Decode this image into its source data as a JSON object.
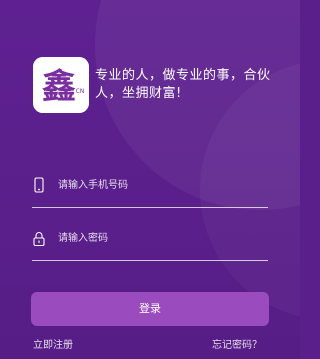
{
  "header": {
    "logo_text": "鑫",
    "logo_sub": "CN",
    "slogan": "专业的人，做专业的事，合伙人，坐拥财富!"
  },
  "form": {
    "phone_placeholder": "请输入手机号码",
    "password_placeholder": "请输入密码",
    "login_label": "登录"
  },
  "footer": {
    "register_label": "立即注册",
    "forgot_label": "忘记密码？"
  },
  "icons": {
    "phone": "phone-icon",
    "lock": "lock-icon",
    "logo": "logo-icon"
  },
  "colors": {
    "background": "#5a1f8a",
    "button": "#9a4bbd",
    "logo_accent": "#7a2fa0"
  }
}
